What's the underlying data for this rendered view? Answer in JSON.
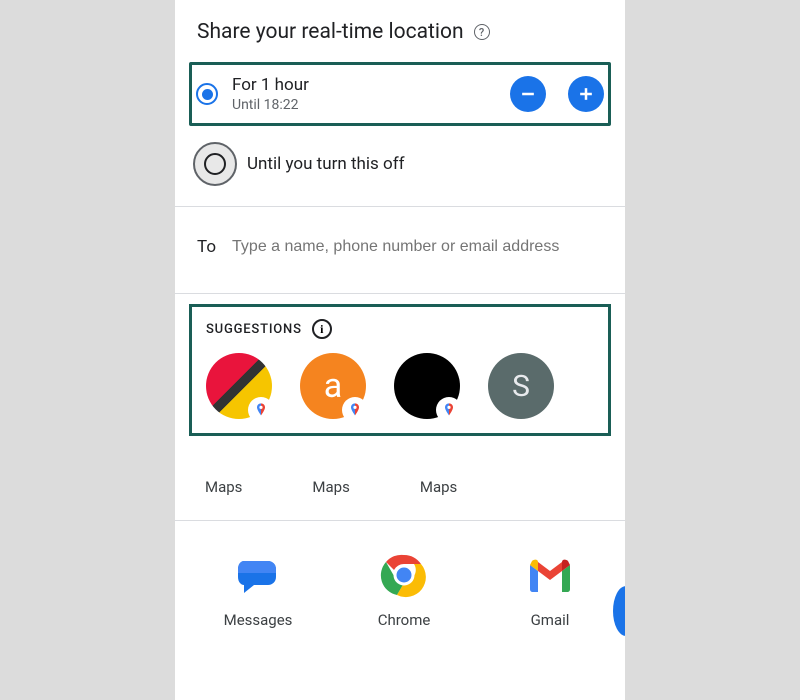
{
  "title": "Share your real-time location",
  "options": {
    "timed": {
      "label": "For 1 hour",
      "until": "Until 18:22",
      "selected": true
    },
    "indefinite": {
      "label": "Until you turn this off",
      "selected": false
    }
  },
  "to": {
    "label": "To",
    "placeholder": "Type a name, phone number or email address"
  },
  "suggestions": {
    "heading": "SUGGESTIONS",
    "contacts": [
      {
        "avatar_style": "multicolor",
        "initial": "",
        "has_maps_badge": true
      },
      {
        "avatar_style": "orange",
        "initial": "a",
        "has_maps_badge": true
      },
      {
        "avatar_style": "black",
        "initial": "",
        "has_maps_badge": true
      },
      {
        "avatar_style": "slate",
        "initial": "S",
        "has_maps_badge": false
      }
    ]
  },
  "app_labels_row": [
    "Maps",
    "Maps",
    "Maps"
  ],
  "share_apps": [
    {
      "name": "Messages",
      "icon": "messages"
    },
    {
      "name": "Chrome",
      "icon": "chrome"
    },
    {
      "name": "Gmail",
      "icon": "gmail"
    }
  ]
}
